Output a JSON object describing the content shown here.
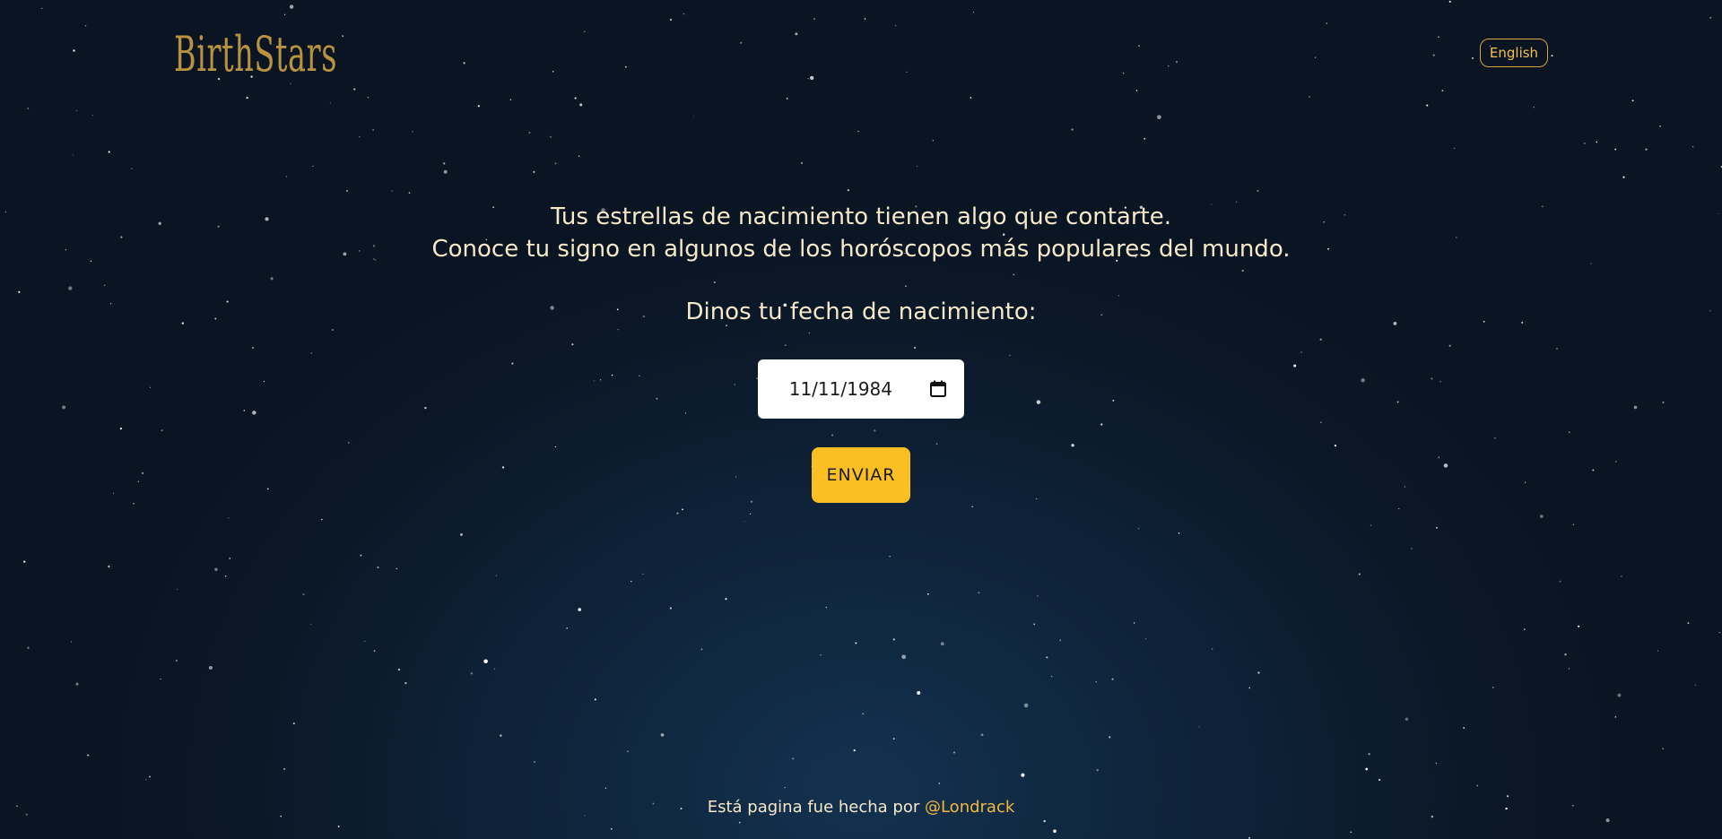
{
  "header": {
    "logo_text": "BirthStars",
    "language_button": "English"
  },
  "main": {
    "intro_line1": "Tus estrellas de nacimiento tienen algo que contarte.",
    "intro_line2": "Conoce tu signo en algunos de los horóscopos más populares del mundo.",
    "question": "Dinos tu fecha de nacimiento:",
    "date_value": "11/11/1984",
    "submit_label": "ENVIAR"
  },
  "footer": {
    "text": "Está pagina fue hecha por ",
    "link_text": "@Londrack"
  },
  "colors": {
    "background": "#0c1a2b",
    "gold": "#b8923f",
    "accent": "#fbbf24",
    "text": "#f6e9c9"
  },
  "icons": {
    "calendar": "calendar-icon"
  }
}
